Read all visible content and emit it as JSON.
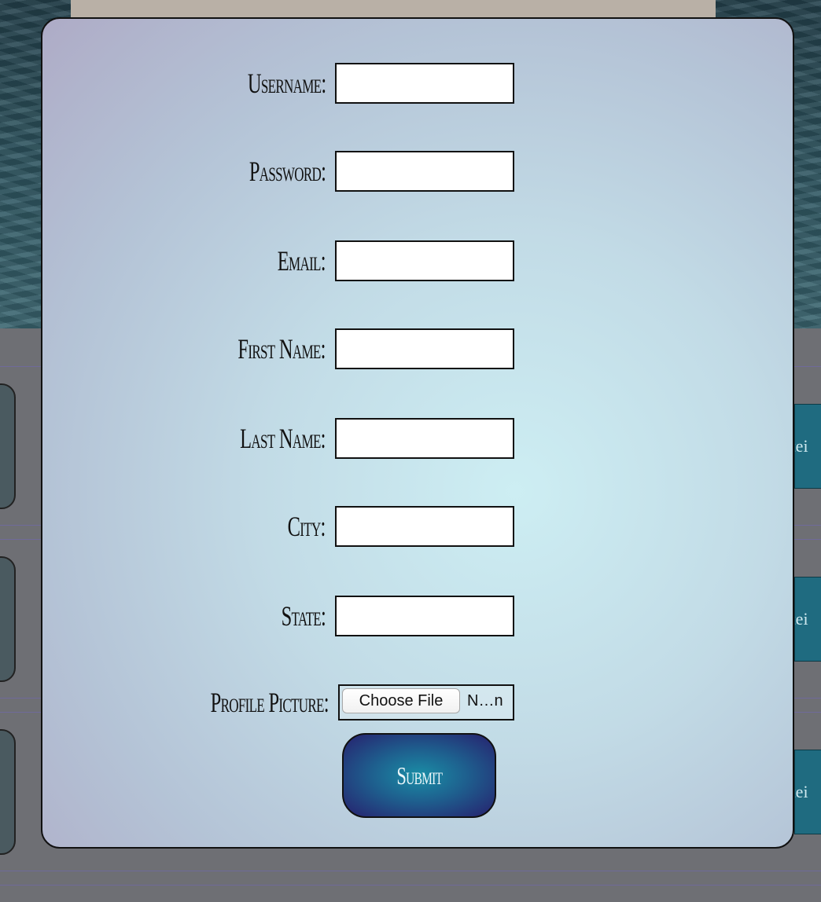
{
  "form": {
    "fields": [
      {
        "label": "Username:",
        "value": ""
      },
      {
        "label": "Password:",
        "value": ""
      },
      {
        "label": "Email:",
        "value": ""
      },
      {
        "label": "First Name:",
        "value": ""
      },
      {
        "label": "Last Name:",
        "value": ""
      },
      {
        "label": "City:",
        "value": ""
      },
      {
        "label": "State:",
        "value": ""
      }
    ],
    "profile_picture": {
      "label": "Profile Picture:",
      "button_label": "Choose File",
      "file_name": "N…n"
    },
    "submit_label": "Submit"
  },
  "background": {
    "side_button_fragment": "stei"
  },
  "colors": {
    "modal_center": "#cdeef3",
    "modal_edge": "#aeabc6",
    "submit_center": "#1a8ea6",
    "submit_edge": "#27206e"
  }
}
